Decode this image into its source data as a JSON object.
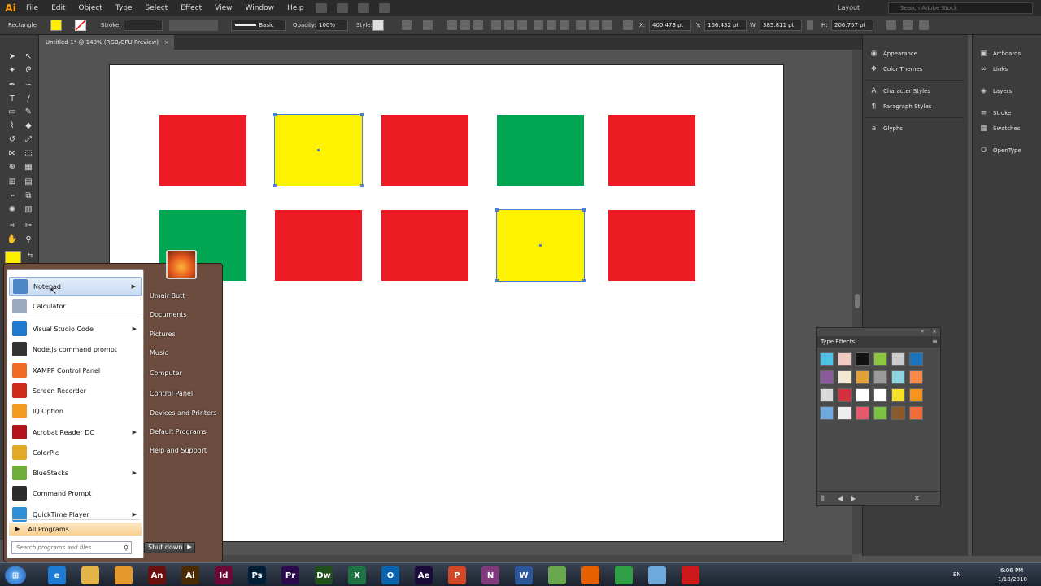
{
  "app": {
    "logo": "Ai",
    "menu": [
      "File",
      "Edit",
      "Object",
      "Type",
      "Select",
      "Effect",
      "View",
      "Window",
      "Help"
    ],
    "workspace": "Layout",
    "stock_search_placeholder": "Search Adobe Stock"
  },
  "control_bar": {
    "tool_name": "Rectangle",
    "fill_color": "#ffed00",
    "stroke_label": "Stroke:",
    "brush_label": "Basic",
    "opacity_label": "Opacity:",
    "opacity_value": "100%",
    "style_label": "Style:",
    "x_label": "X:",
    "x_value": "400.473 pt",
    "y_label": "Y:",
    "y_value": "166.432 pt",
    "w_label": "W:",
    "w_value": "385.811 pt",
    "h_label": "H:",
    "h_value": "206.757 pt"
  },
  "document_tab": {
    "title": "Untitled-1* @ 148% (RGB/GPU Preview)",
    "close": "×"
  },
  "artboard": {
    "rects": [
      {
        "row": 1,
        "col": 1,
        "color": "#ed1c24",
        "selected": false
      },
      {
        "row": 1,
        "col": 2,
        "color": "#fff200",
        "selected": true
      },
      {
        "row": 1,
        "col": 3,
        "color": "#ed1c24",
        "selected": false
      },
      {
        "row": 1,
        "col": 4,
        "color": "#00a651",
        "selected": false
      },
      {
        "row": 1,
        "col": 5,
        "color": "#ed1c24",
        "selected": false
      },
      {
        "row": 2,
        "col": 1,
        "color": "#00a651",
        "selected": false
      },
      {
        "row": 2,
        "col": 2,
        "color": "#ed1c24",
        "selected": false
      },
      {
        "row": 2,
        "col": 3,
        "color": "#ed1c24",
        "selected": false
      },
      {
        "row": 2,
        "col": 4,
        "color": "#fff200",
        "selected": true
      },
      {
        "row": 2,
        "col": 5,
        "color": "#ed1c24",
        "selected": false
      }
    ]
  },
  "panels_col1": [
    "Appearance",
    "Color Themes",
    "Character Styles",
    "Paragraph Styles",
    "Glyphs"
  ],
  "panels_col2": [
    "Artboards",
    "Links",
    "Layers",
    "Stroke",
    "Swatches",
    "OpenType"
  ],
  "type_effects": {
    "title": "Type Effects",
    "swatches": [
      "#4fc3e6",
      "#f1c9c0",
      "#111111",
      "#8dc63f",
      "#cccccc",
      "#1c75bc",
      "#8a5a9a",
      "#f3e9d2",
      "#e2a13b",
      "#9a9a9a",
      "#8dd3e0",
      "#f58a4b",
      "#d9d9d9",
      "#d32f3c",
      "#ffffff",
      "#ffffff",
      "#f5e12a",
      "#f7941d",
      "#6fa8dc",
      "#eeeeee",
      "#e8576b",
      "#7cc242",
      "#8a5a2b",
      "#f26b3a"
    ]
  },
  "start_menu": {
    "programs": [
      {
        "label": "Notepad",
        "icon": "notepad-icon",
        "color": "#4f86c6",
        "arrow": true,
        "highlighted": true
      },
      {
        "label": "Calculator",
        "icon": "calculator-icon",
        "color": "#9aaac0",
        "arrow": false,
        "highlighted": false
      },
      {
        "label": "Visual Studio Code",
        "icon": "vscode-icon",
        "color": "#1f7ad1",
        "arrow": true,
        "highlighted": false
      },
      {
        "label": "Node.js command prompt",
        "icon": "nodejs-icon",
        "color": "#333333",
        "arrow": false,
        "highlighted": false
      },
      {
        "label": "XAMPP Control Panel",
        "icon": "xampp-icon",
        "color": "#f26a21",
        "arrow": false,
        "highlighted": false
      },
      {
        "label": "Screen Recorder",
        "icon": "screen-recorder-icon",
        "color": "#cc2a1a",
        "arrow": false,
        "highlighted": false
      },
      {
        "label": "IQ Option",
        "icon": "iq-option-icon",
        "color": "#f39a1e",
        "arrow": false,
        "highlighted": false
      },
      {
        "label": "Acrobat Reader DC",
        "icon": "acrobat-icon",
        "color": "#b3121b",
        "arrow": true,
        "highlighted": false
      },
      {
        "label": "ColorPic",
        "icon": "colorpic-icon",
        "color": "#e3a72a",
        "arrow": false,
        "highlighted": false
      },
      {
        "label": "BlueStacks",
        "icon": "bluestacks-icon",
        "color": "#6fae3a",
        "arrow": true,
        "highlighted": false
      },
      {
        "label": "Command Prompt",
        "icon": "command-prompt-icon",
        "color": "#2b2b2b",
        "arrow": false,
        "highlighted": false
      },
      {
        "label": "QuickTime Player",
        "icon": "quicktime-icon",
        "color": "#2e8fd6",
        "arrow": true,
        "highlighted": false
      }
    ],
    "all_programs": "All Programs",
    "search_placeholder": "Search programs and files",
    "right_links": [
      "Umair Butt",
      "Documents",
      "Pictures",
      "Music",
      "Computer",
      "Control Panel",
      "Devices and Printers",
      "Default Programs",
      "Help and Support"
    ],
    "shutdown": "Shut down"
  },
  "taskbar": {
    "apps": [
      {
        "name": "ie-icon",
        "label": "e",
        "color": "#1e7bd3"
      },
      {
        "name": "explorer-icon",
        "label": "",
        "color": "#e3b54a"
      },
      {
        "name": "media-player-icon",
        "label": "",
        "color": "#e39a2a"
      },
      {
        "name": "animate-icon",
        "label": "An",
        "color": "#6a0e0e"
      },
      {
        "name": "illustrator-icon",
        "label": "Ai",
        "color": "#4a2a00"
      },
      {
        "name": "indesign-icon",
        "label": "Id",
        "color": "#6b0a36"
      },
      {
        "name": "photoshop-icon",
        "label": "Ps",
        "color": "#001e36"
      },
      {
        "name": "premiere-icon",
        "label": "Pr",
        "color": "#2a0a4a"
      },
      {
        "name": "dreamweaver-icon",
        "label": "Dw",
        "color": "#1f4f1a"
      },
      {
        "name": "excel-icon",
        "label": "X",
        "color": "#1f7244"
      },
      {
        "name": "outlook-icon",
        "label": "O",
        "color": "#0a64ad"
      },
      {
        "name": "after-effects-icon",
        "label": "Ae",
        "color": "#1a0a3a"
      },
      {
        "name": "powerpoint-icon",
        "label": "P",
        "color": "#d24726"
      },
      {
        "name": "onenote-icon",
        "label": "N",
        "color": "#80397b"
      },
      {
        "name": "word-icon",
        "label": "W",
        "color": "#2b579a"
      },
      {
        "name": "sublime-icon",
        "label": "",
        "color": "#6aa84f"
      },
      {
        "name": "firefox-icon",
        "label": "",
        "color": "#e66000"
      },
      {
        "name": "chrome-icon",
        "label": "",
        "color": "#2f9e44"
      },
      {
        "name": "notepad-icon",
        "label": "",
        "color": "#6fa8dc"
      },
      {
        "name": "recorder-icon",
        "label": "",
        "color": "#cc1a1a"
      }
    ],
    "lang": "EN",
    "time": "6:06 PM",
    "date": "1/18/2018"
  }
}
